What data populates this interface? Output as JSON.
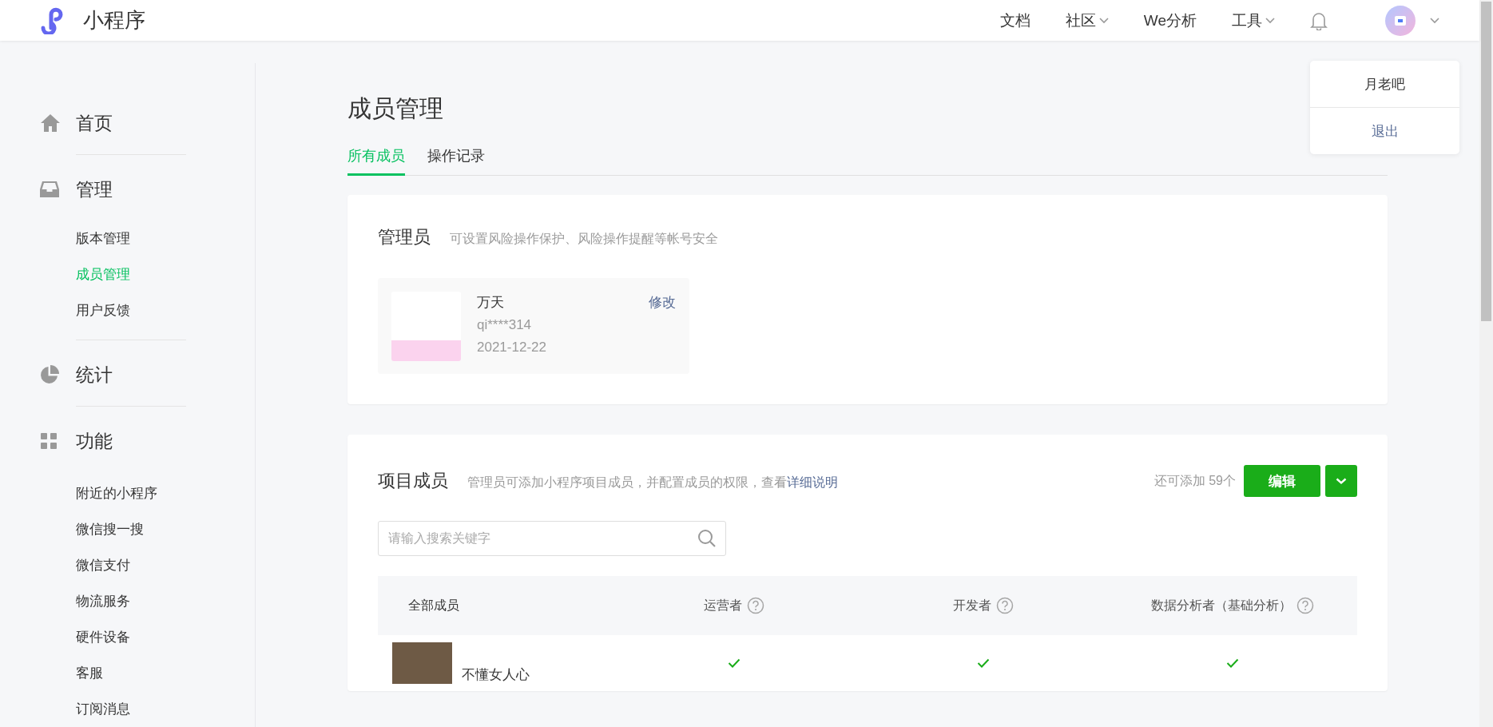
{
  "logo": {
    "text": "小程序"
  },
  "nav": [
    {
      "label": "文档",
      "has_menu": false
    },
    {
      "label": "社区",
      "has_menu": true
    },
    {
      "label": "We分析",
      "has_menu": false
    },
    {
      "label": "工具",
      "has_menu": true
    }
  ],
  "account_menu": {
    "items": [
      {
        "label": "月老吧",
        "kind": "name"
      },
      {
        "label": "退出",
        "kind": "link"
      }
    ]
  },
  "sidebar": {
    "sections": [
      {
        "label": "首页",
        "kind": "home"
      },
      {
        "label": "管理",
        "kind": "inbox",
        "items": [
          {
            "label": "版本管理",
            "selected": false
          },
          {
            "label": "成员管理",
            "selected": true
          },
          {
            "label": "用户反馈",
            "selected": false
          }
        ]
      },
      {
        "label": "统计",
        "kind": "pie"
      },
      {
        "label": "功能",
        "kind": "grid",
        "items": [
          {
            "label": "附近的小程序",
            "selected": false
          },
          {
            "label": "微信搜一搜",
            "selected": false
          },
          {
            "label": "微信支付",
            "selected": false
          },
          {
            "label": "物流服务",
            "selected": false
          },
          {
            "label": "硬件设备",
            "selected": false
          },
          {
            "label": "客服",
            "selected": false
          },
          {
            "label": "订阅消息",
            "selected": false
          }
        ]
      }
    ]
  },
  "page": {
    "title": "成员管理",
    "tabs": [
      {
        "label": "所有成员",
        "selected": true
      },
      {
        "label": "操作记录",
        "selected": false
      }
    ]
  },
  "admin_card": {
    "title": "管理员",
    "description": "可设置风险操作保护、风险操作提醒等帐号安全",
    "admin": {
      "name": "万天",
      "account": "qi****314",
      "date": "2021-12-22",
      "action": "修改"
    }
  },
  "members_card": {
    "title": "项目成员",
    "description": "管理员可添加小程序项目成员，并配置成员的权限，查看",
    "link": "详细说明",
    "remaining": "还可添加 59个",
    "edit_button": "编辑",
    "search": {
      "placeholder": "请输入搜索关键字"
    },
    "columns": [
      {
        "label": "全部成员",
        "help": false
      },
      {
        "label": "运营者",
        "help": true
      },
      {
        "label": "开发者",
        "help": true
      },
      {
        "label": "数据分析者（基础分析）",
        "help": true
      }
    ],
    "rows": [
      {
        "name": "不懂女人心",
        "permissions": [
          true,
          true,
          true
        ]
      }
    ]
  }
}
